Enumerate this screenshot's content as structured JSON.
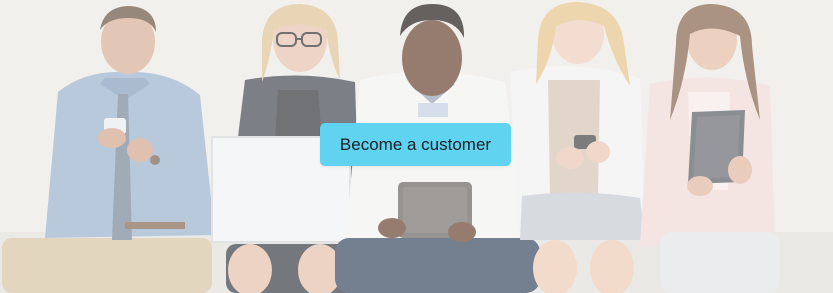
{
  "hero": {
    "cta_label": "Become a customer",
    "cta_color": "#5fd3ef",
    "image_subject": "five-people-seated-using-devices"
  }
}
